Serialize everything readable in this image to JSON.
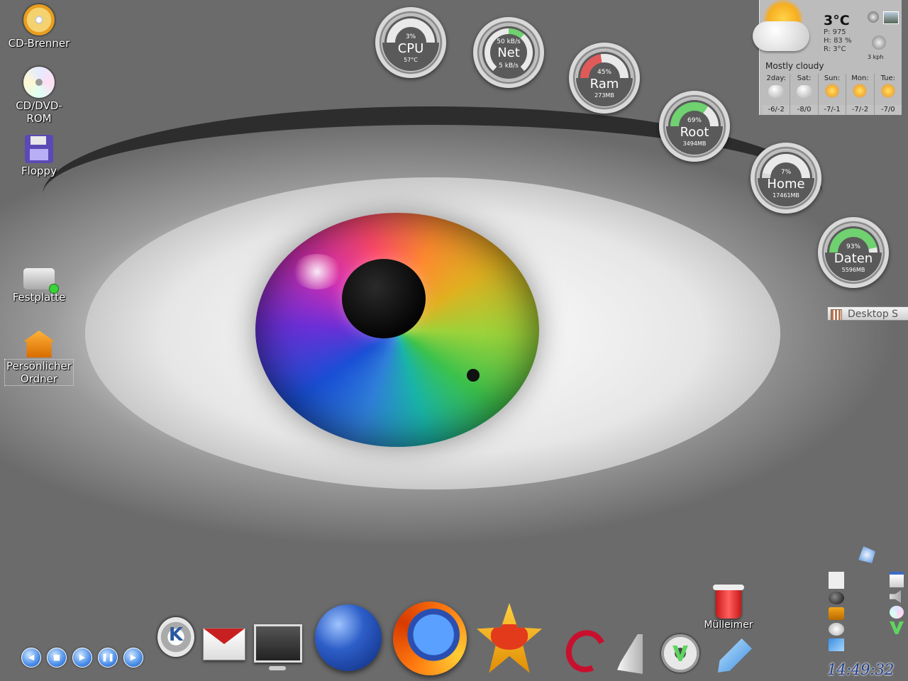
{
  "desktop_icons": {
    "cd_burner": "CD-Brenner",
    "cd_dvd_rom": "CD/DVD-ROM",
    "floppy": "Floppy",
    "harddisk": "Festplatte",
    "home_folder": "Persönlicher Ordner",
    "trash": "Mülleimer"
  },
  "gauges": {
    "cpu": {
      "name": "CPU",
      "percent_label": "3%",
      "sub": "57°C",
      "percent": 3,
      "color": "#e9e9e9"
    },
    "net": {
      "name": "Net",
      "top": "50 kB/s",
      "sub": "5 kB/s"
    },
    "ram": {
      "name": "Ram",
      "percent_label": "45%",
      "sub": "273MB",
      "percent": 45,
      "color": "#e05a5a"
    },
    "root": {
      "name": "Root",
      "percent_label": "69%",
      "sub": "3494MB",
      "percent": 69,
      "color": "#6fd16f"
    },
    "home": {
      "name": "Home",
      "percent_label": "7%",
      "sub": "17461MB",
      "percent": 7,
      "color": "#d8d8d8"
    },
    "daten": {
      "name": "Daten",
      "percent_label": "93%",
      "sub": "5596MB",
      "percent": 93,
      "color": "#6fd16f"
    }
  },
  "weather": {
    "temp": "3°C",
    "pressure": "P: 975",
    "humidity": "H: 83 %",
    "realfeel": "R: 3°C",
    "wind": "3 kph",
    "description": "Mostly cloudy",
    "forecast": [
      {
        "day": "2day:",
        "temps": "-6/-2",
        "icon": "cloudy-icon"
      },
      {
        "day": "Sat:",
        "temps": "-8/0",
        "icon": "cloudy-icon"
      },
      {
        "day": "Sun:",
        "temps": "-7/-1",
        "icon": "sunny-icon"
      },
      {
        "day": "Mon:",
        "temps": "-7/-2",
        "icon": "sunny-icon"
      },
      {
        "day": "Tue:",
        "temps": "-7/0",
        "icon": "sunny-icon"
      }
    ]
  },
  "desktop_tab": {
    "label": "Desktop S"
  },
  "media_controls": [
    "◀",
    "■",
    "▶",
    "❚❚",
    "▶"
  ],
  "clock": "14:49:32"
}
